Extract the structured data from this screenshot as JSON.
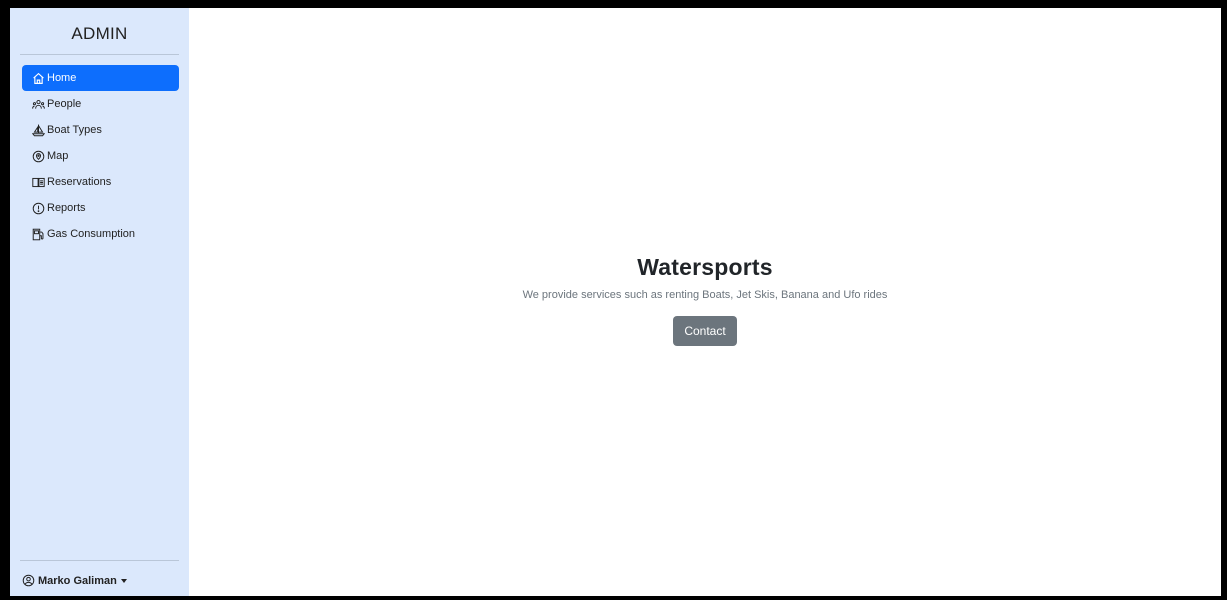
{
  "sidebar": {
    "brand": "ADMIN",
    "items": [
      {
        "label": "Home",
        "icon": "home-icon",
        "active": true
      },
      {
        "label": "People",
        "icon": "people-icon",
        "active": false
      },
      {
        "label": "Boat Types",
        "icon": "sailboat-icon",
        "active": false
      },
      {
        "label": "Map",
        "icon": "map-pin-icon",
        "active": false
      },
      {
        "label": "Reservations",
        "icon": "book-icon",
        "active": false
      },
      {
        "label": "Reports",
        "icon": "alert-circle-icon",
        "active": false
      },
      {
        "label": "Gas Consumption",
        "icon": "fuel-pump-icon",
        "active": false
      }
    ],
    "user": {
      "name": "Marko Galiman",
      "icon": "user-circle-icon"
    }
  },
  "hero": {
    "title": "Watersports",
    "subtitle": "We provide services such as renting Boats, Jet Skis, Banana and Ufo rides",
    "button_label": "Contact"
  },
  "colors": {
    "sidebar_bg": "#dbe8fc",
    "active_bg": "#0d6efd",
    "button_bg": "#6c757d"
  }
}
